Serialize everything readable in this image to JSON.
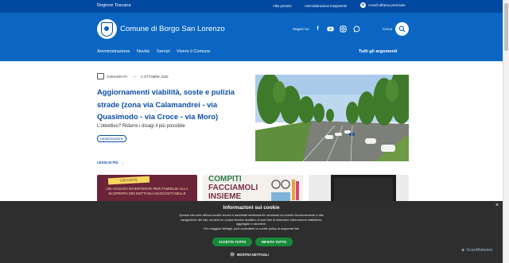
{
  "top_bar": {
    "region": "Regione Toscana",
    "links": [
      "Albo pretorio",
      "Amministrazione trasparente"
    ],
    "login": "Accedi all'area personale"
  },
  "header": {
    "title": "Comune di Borgo San Lorenzo",
    "social_label": "Seguici su",
    "social_icons": [
      "facebook-icon",
      "youtube-icon",
      "instagram-icon",
      "whatsapp-icon"
    ],
    "search_label": "Cerca",
    "nav": [
      "Amministrazione",
      "Novità",
      "Servizi",
      "Vivere il Comune"
    ],
    "all_topics": "Tutti gli argomenti"
  },
  "featured": {
    "category": "COMUNICATI",
    "separator": "—",
    "date": "6 OTTOBRE 2025",
    "headline": "Aggiornamenti viabilità, soste e pulizia strade (zona via Calamandrei - via Quasimodo - via Croce - via Moro)",
    "subtitle": "L'obiettivo? Ridurre i disagi il più possibile",
    "tag": "Urbanizzazione",
    "read_more": "LEGGI DI PIÙ"
  },
  "cards": [
    {
      "line1": "CACCIA AL PARTICOLARE",
      "line2": "UN VIAGGIO DIVERTENTE PER FAMIGLIE ALLA SCOPERTA DEI DETTAGLI NASCOSTI NELLE"
    },
    {
      "line1": "COMPITI",
      "line2": "FACCIAMOLI",
      "line3": "INSIEME"
    },
    {
      "line1": ""
    }
  ],
  "cookie": {
    "title": "Informazioni sui cookie",
    "text": [
      "Questo sito web utilizza cookie tecnici e assimilati strettamente necessari al corretto funzionamento e alla",
      "navigazione del sito, nonché un cookie tecnico analitico al solo fine di elaborare informazioni statistiche,",
      "aggregate e anonime.",
      "Per maggiori dettagli, puoi consultare la cookie policy al seguente link"
    ],
    "accept": "ACCETTA TUTTO",
    "reject": "RIFIUTA TUTTO",
    "details": "MOSTRA DETTAGLI",
    "close": "×"
  },
  "watermark": "ScanMalware",
  "colors": {
    "top_bar": "#0048a0",
    "header": "#0a66c2",
    "link": "#0a4ea8",
    "cookie_bg": "#2e2e2e",
    "button_green": "#178a3a"
  }
}
